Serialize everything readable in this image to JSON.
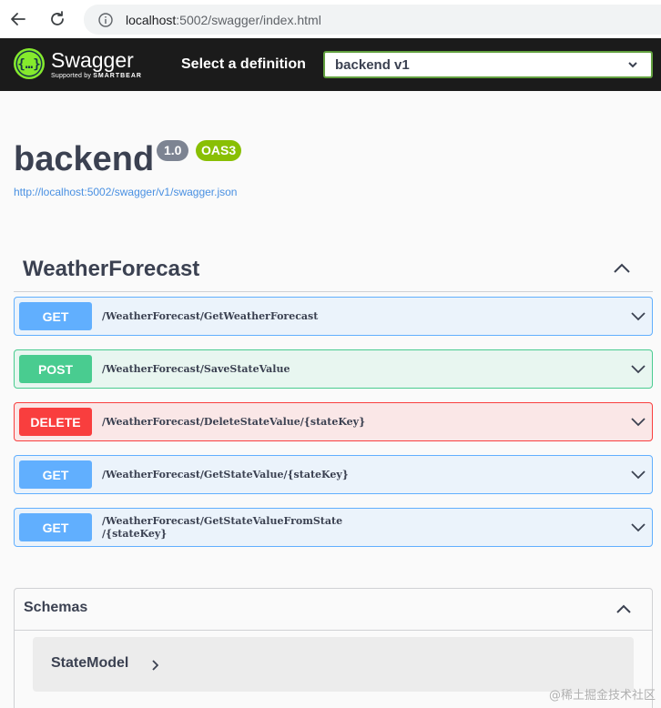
{
  "browser": {
    "url_host": "localhost",
    "url_rest": ":5002/swagger/index.html"
  },
  "topbar": {
    "logo_title": "Swagger",
    "logo_sub_prefix": "Supported by",
    "logo_sub_brand": "SMARTBEAR",
    "definition_label": "Select a definition",
    "definition_value": "backend v1"
  },
  "info": {
    "title": "backend",
    "version": "1.0",
    "oas": "OAS3",
    "spec_url": "http://localhost:5002/swagger/v1/swagger.json"
  },
  "tag": {
    "name": "WeatherForecast"
  },
  "operations": [
    {
      "method": "GET",
      "path": "/WeatherForecast/GetWeatherForecast",
      "path2": ""
    },
    {
      "method": "POST",
      "path": "/WeatherForecast/SaveStateValue",
      "path2": ""
    },
    {
      "method": "DELETE",
      "path": "/WeatherForecast/DeleteStateValue/{stateKey}",
      "path2": ""
    },
    {
      "method": "GET",
      "path": "/WeatherForecast/GetStateValue/{stateKey}",
      "path2": ""
    },
    {
      "method": "GET",
      "path": "/WeatherForecast/GetStateValueFromState",
      "path2": "/{stateKey}"
    }
  ],
  "schemas": {
    "title": "Schemas",
    "models": [
      {
        "name": "StateModel"
      }
    ]
  },
  "watermark": "@稀土掘金技术社区",
  "colors": {
    "get": "#61affe",
    "post": "#49cc90",
    "delete": "#f93e3e",
    "topbar": "#1b1b1b",
    "select_border": "#62a03f",
    "oas_badge": "#89bf04"
  }
}
